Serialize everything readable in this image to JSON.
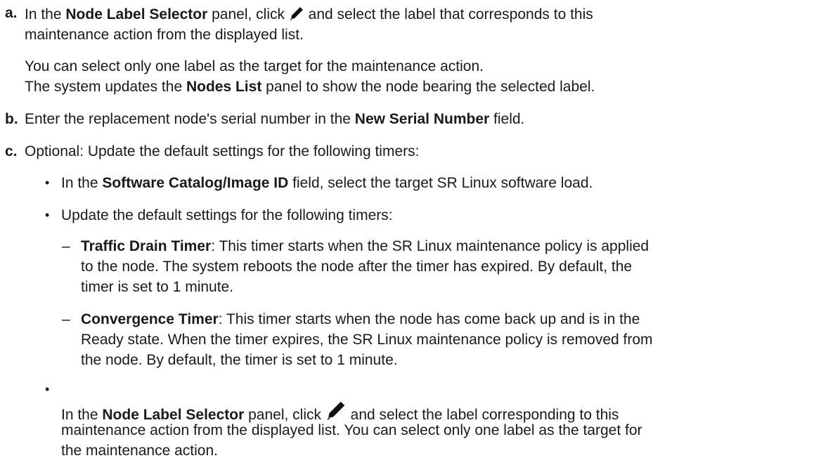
{
  "step_a": {
    "label": "a.",
    "line1": {
      "t1": "In the ",
      "b1": "Node Label Selector",
      "t2": " panel, click ",
      "t3": " and select the label that corresponds to this"
    },
    "line2": "maintenance action from the displayed list.",
    "line3": "You can select only one label as the target for the maintenance action.",
    "line4": {
      "t1": "The system updates the ",
      "b1": "Nodes List",
      "t2": " panel to show the node bearing the selected label."
    }
  },
  "step_b": {
    "label": "b.",
    "line1": {
      "t1": "Enter the replacement node's serial number in the ",
      "b1": "New Serial Number",
      "t2": " field."
    }
  },
  "step_c": {
    "label": "c.",
    "line1": "Optional: Update the default settings for the following timers:",
    "bullet_char": "•",
    "bullet1": {
      "t1": "In the ",
      "b1": "Software Catalog/Image ID",
      "t2": " field, select the target SR Linux software load."
    },
    "bullet2": "Update the default settings for the following timers:",
    "dash_char": "–",
    "dash1": {
      "b1": "Traffic Drain Timer",
      "l1": ": This timer starts when the SR Linux maintenance policy is applied",
      "l2": "to the node. The system reboots the node after the timer has expired. By default, the",
      "l3": "timer is set to 1 minute."
    },
    "dash2": {
      "b1": "Convergence Timer",
      "l1": ": This timer starts when the node has come back up and is in the",
      "l2": "Ready state. When the timer expires, the SR Linux maintenance policy is removed from",
      "l3": "the node. By default, the timer is set to 1 minute."
    },
    "bullet3": {
      "t1": "In the ",
      "b1": "Node Label Selector",
      "t2": " panel, click ",
      "t3": " and select the label corresponding to this",
      "l2": "maintenance action from the displayed list. You can select only one label as the target for",
      "l3": "the maintenance action."
    }
  },
  "icons": {
    "edit": "pencil-icon"
  }
}
